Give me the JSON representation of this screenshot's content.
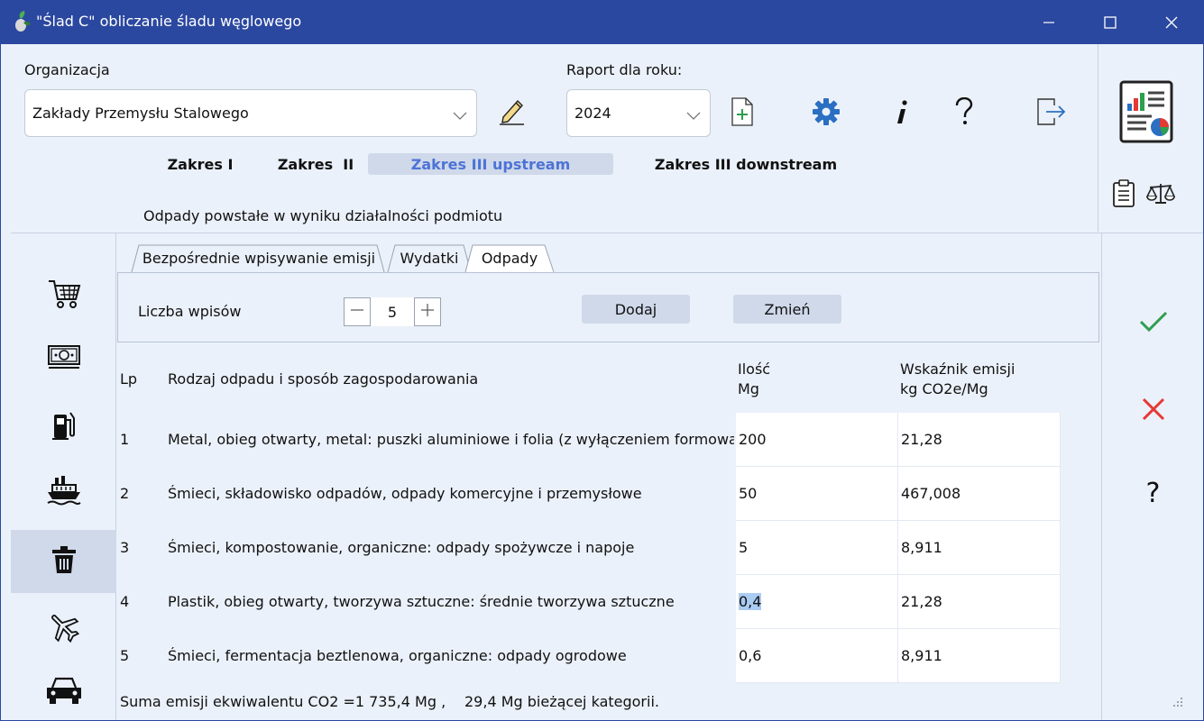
{
  "window": {
    "title": "\"Ślad C\" obliczanie śladu węglowego",
    "minimize_icon": "minimize-icon",
    "maximize_icon": "maximize-icon",
    "close_icon": "close-icon",
    "titlebar_color": "#2b48a0"
  },
  "header": {
    "organization_label": "Organizacja",
    "organization_value": "Zakłady Przemysłu Stalowego",
    "year_label": "Raport dla roku:",
    "year_value": "2024",
    "subtitle": "Odpady powstałe w wyniku działalności podmiotu",
    "icons": [
      "edit-icon",
      "new-report-icon",
      "settings-icon",
      "info-icon",
      "help-icon",
      "exit-icon"
    ]
  },
  "scopes": [
    {
      "label": "Zakres I",
      "active": false
    },
    {
      "label": "Zakres  II",
      "active": false
    },
    {
      "label": "Zakres III upstream",
      "active": true
    },
    {
      "label": "Zakres III downstream",
      "active": false
    }
  ],
  "right_panel": {
    "icons": [
      "report-icon",
      "clipboard-icon",
      "scales-icon"
    ]
  },
  "sidebar": {
    "items": [
      {
        "icon": "shopping-cart-icon",
        "active": false
      },
      {
        "icon": "money-icon",
        "active": false
      },
      {
        "icon": "fuel-pump-icon",
        "active": false
      },
      {
        "icon": "ship-icon",
        "active": false
      },
      {
        "icon": "trash-icon",
        "active": true
      },
      {
        "icon": "airplane-icon",
        "active": false
      },
      {
        "icon": "car-icon",
        "active": false
      }
    ]
  },
  "tabs": [
    {
      "label": "Bezpośrednie wpisywanie emisji",
      "active": false
    },
    {
      "label": "Wydatki",
      "active": false
    },
    {
      "label": "Odpady",
      "active": true
    }
  ],
  "toolbar": {
    "count_label": "Liczba wpisów",
    "count_value": "5",
    "add_label": "Dodaj",
    "change_label": "Zmień"
  },
  "table": {
    "headers": {
      "lp": "Lp",
      "type": "Rodzaj odpadu i sposób zagospodarowania",
      "qty_line1": "Ilość",
      "qty_line2": "Mg",
      "factor_line1": "Wskaźnik emisji",
      "factor_line2": "kg CO2e/Mg"
    },
    "rows": [
      {
        "lp": "1",
        "type": "Metal, obieg otwarty, metal: puszki aluminiowe i folia (z wyłączeniem formowa",
        "qty": "200",
        "factor": "21,28"
      },
      {
        "lp": "2",
        "type": "Śmieci, składowisko odpadów, odpady komercyjne i przemysłowe",
        "qty": "50",
        "factor": "467,008"
      },
      {
        "lp": "3",
        "type": "Śmieci, kompostowanie, organiczne: odpady spożywcze i napoje",
        "qty": "5",
        "factor": "8,911"
      },
      {
        "lp": "4",
        "type": "Plastik, obieg otwarty, tworzywa sztuczne: średnie tworzywa sztuczne",
        "qty": "0,4",
        "factor": "21,28"
      },
      {
        "lp": "5",
        "type": "Śmieci, fermentacja beztlenowa, organiczne: odpady ogrodowe",
        "qty": "0,6",
        "factor": "8,911"
      }
    ]
  },
  "actions": {
    "icons": [
      "confirm-icon",
      "cancel-icon",
      "help-icon"
    ],
    "help_glyph": "?"
  },
  "status": {
    "total": "Suma emisji ekwiwalentu CO2 =1 735,4 Mg ,",
    "category": "29,4 Mg bieżącej kategorii."
  },
  "colors": {
    "accent": "#2b48a0",
    "panel_bg": "#ebf1fa",
    "active_bg": "#cfd9ea",
    "active_scope_text": "#4d73d6",
    "confirm": "#2e9e4f",
    "cancel": "#e53935",
    "settings": "#2a6fc2",
    "selection": "#aacbf2"
  }
}
